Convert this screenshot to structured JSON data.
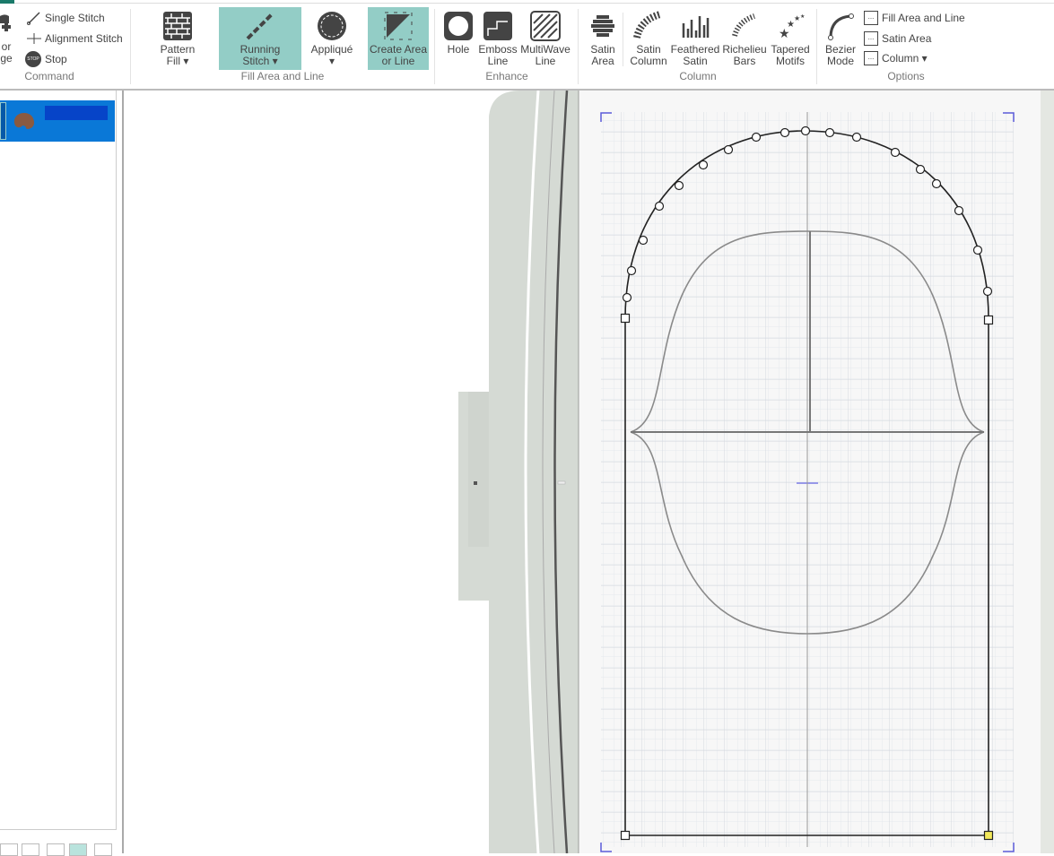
{
  "ribbon": {
    "command": {
      "color_change_partial": "or",
      "change_partial": "ge",
      "single_stitch": "Single Stitch",
      "alignment_stitch": "Alignment Stitch",
      "stop": "Stop",
      "stop_icon_text": "STOP",
      "group": "Command"
    },
    "fill": {
      "pattern_fill": [
        "Pattern",
        "Fill ▾"
      ],
      "running_stitch": [
        "Running",
        "Stitch ▾"
      ],
      "applique": [
        "Appliqué",
        "▾"
      ],
      "create_area": [
        "Create Area",
        "or Line"
      ],
      "group": "Fill Area and Line"
    },
    "enhance": {
      "hole": "Hole",
      "emboss": [
        "Emboss",
        "Line"
      ],
      "multiwave": [
        "MultiWave",
        "Line"
      ],
      "group": "Enhance"
    },
    "column": {
      "satin_area": [
        "Satin",
        "Area"
      ],
      "satin_column": [
        "Satin",
        "Column"
      ],
      "feathered": [
        "Feathered",
        "Satin"
      ],
      "richelieu": [
        "Richelieu",
        "Bars"
      ],
      "tapered": [
        "Tapered",
        "Motifs"
      ],
      "group": "Column"
    },
    "options": {
      "bezier": [
        "Bezier",
        "Mode"
      ],
      "fill_area_line": "Fill Area and Line",
      "satin_area": "Satin Area",
      "column": "Column ▾",
      "group": "Options"
    }
  },
  "colors": {
    "selected": "#93cdc6",
    "layer": "#0a78d7",
    "hoop": "#d5dad4"
  }
}
